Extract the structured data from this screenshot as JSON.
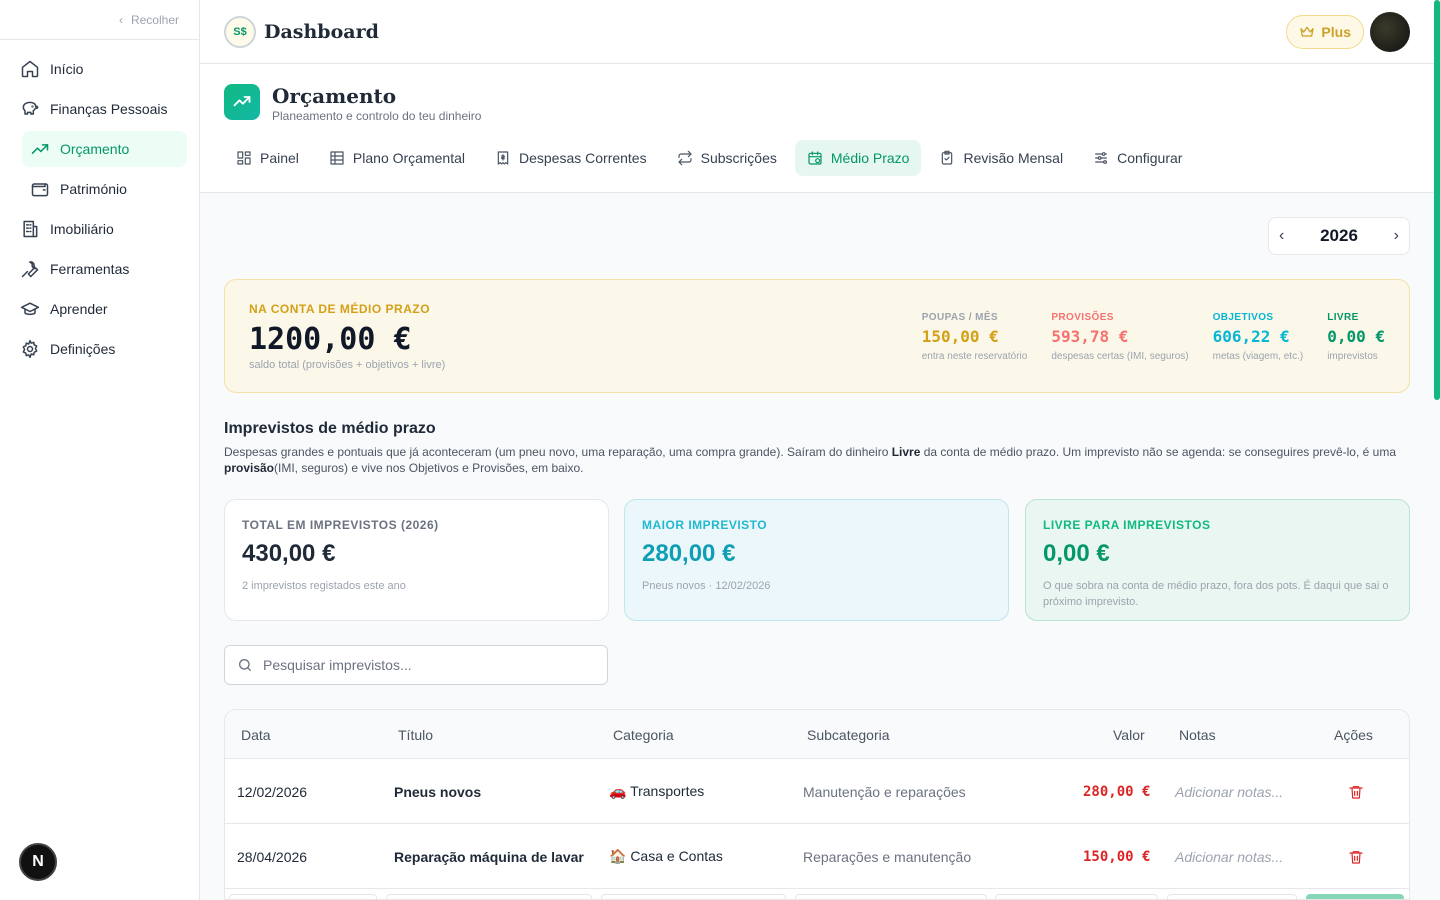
{
  "sidebar": {
    "collapse_label": "Recolher",
    "items": [
      {
        "label": "Início"
      },
      {
        "label": "Finanças Pessoais"
      },
      {
        "label": "Orçamento"
      },
      {
        "label": "Património"
      },
      {
        "label": "Imobiliário"
      },
      {
        "label": "Ferramentas"
      },
      {
        "label": "Aprender"
      },
      {
        "label": "Definições"
      }
    ],
    "badge_letter": "N"
  },
  "topbar": {
    "logo_text": "S$",
    "title": "Dashboard",
    "plus_label": "Plus"
  },
  "header": {
    "title": "Orçamento",
    "subtitle": "Planeamento e controlo do teu dinheiro",
    "tabs": [
      {
        "label": "Painel"
      },
      {
        "label": "Plano Orçamental"
      },
      {
        "label": "Despesas Correntes"
      },
      {
        "label": "Subscrições"
      },
      {
        "label": "Médio Prazo"
      },
      {
        "label": "Revisão Mensal"
      },
      {
        "label": "Configurar"
      }
    ]
  },
  "year_selector": {
    "year": "2026"
  },
  "summary": {
    "label": "NA CONTA DE MÉDIO PRAZO",
    "value": "1200,00 €",
    "note": "saldo total (provisões + objetivos + livre)",
    "stats": [
      {
        "label": "POUPAS / MÊS",
        "value": "150,00 €",
        "note": "entra neste reservatório",
        "color": "#d4a017"
      },
      {
        "label": "PROVISÕES",
        "value": "593,78 €",
        "note": "despesas certas (IMI, seguros)",
        "color": "#f87171"
      },
      {
        "label": "OBJETIVOS",
        "value": "606,22 €",
        "note": "metas (viagem, etc.)",
        "color": "#06b6d4"
      },
      {
        "label": "LIVRE",
        "value": "0,00 €",
        "note": "imprevistos",
        "color": "#059669"
      }
    ]
  },
  "section": {
    "title": "Imprevistos de médio prazo",
    "desc_part1": "Despesas grandes e pontuais que já aconteceram (um pneu novo, uma reparação, uma compra grande). Saíram do dinheiro ",
    "desc_bold1": "Livre",
    "desc_part2": " da conta de médio prazo. Um imprevisto não se agenda: se conseguires prevê-lo, é uma ",
    "desc_bold2": "provisão",
    "desc_part3": "(IMI, seguros) e vive nos Objetivos e Provisões, em baixo."
  },
  "cards": [
    {
      "label": "TOTAL EM IMPREVISTOS (2026)",
      "value": "430,00 €",
      "note": "2 imprevistos registados este ano"
    },
    {
      "label": "MAIOR IMPREVISTO",
      "value": "280,00 €",
      "note": "Pneus novos · 12/02/2026"
    },
    {
      "label": "LIVRE PARA IMPREVISTOS",
      "value": "0,00 €",
      "note": "O que sobra na conta de médio prazo, fora dos pots. É daqui que sai o próximo imprevisto."
    }
  ],
  "search": {
    "placeholder": "Pesquisar imprevistos..."
  },
  "table": {
    "headers": [
      "Data",
      "Título",
      "Categoria",
      "Subcategoria",
      "Valor",
      "Notas",
      "Ações"
    ],
    "rows": [
      {
        "date": "12/02/2026",
        "title": "Pneus novos",
        "category": "🚗 Transportes",
        "subcategory": "Manutenção e reparações",
        "value": "280,00 €",
        "notes_placeholder": "Adicionar notas..."
      },
      {
        "date": "28/04/2026",
        "title": "Reparação máquina de lavar",
        "category": "🏠 Casa e Contas",
        "subcategory": "Reparações e manutenção",
        "value": "150,00 €",
        "notes_placeholder": "Adicionar notas..."
      }
    ]
  },
  "colors": {
    "accent": "#059669",
    "danger": "#dc2626",
    "gold": "#d4a017"
  }
}
